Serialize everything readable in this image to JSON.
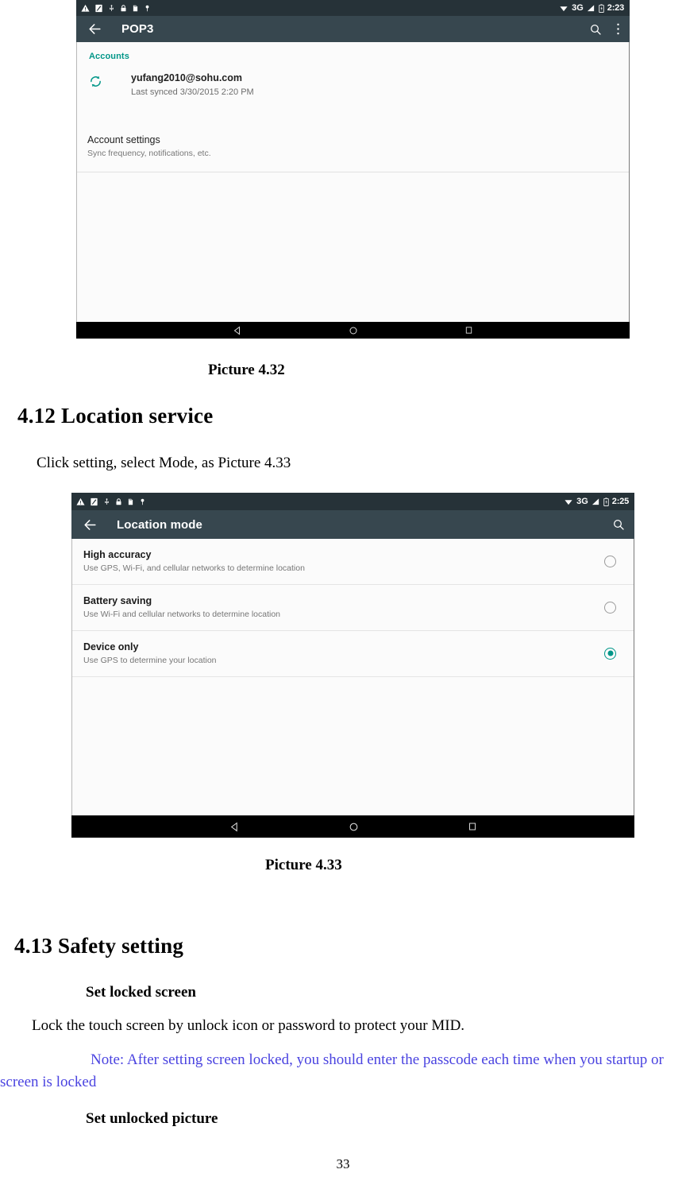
{
  "document": {
    "page_number": "33",
    "caption_1": "Picture 4.32",
    "caption_2": "Picture 4.33",
    "heading_412": "4.12 Location service",
    "paragraph_412": "Click setting, select Mode, as Picture 4.33",
    "heading_413": "4.13   Safety setting",
    "sub_locked": "Set locked screen",
    "paragraph_lock": "Lock the touch screen by unlock icon or password to protect your MID.",
    "note_text": "Note: After setting screen locked, you should enter the passcode each time when you startup or screen is locked",
    "note_color": "#4a43e0",
    "sub_unlocked": "Set unlocked picture"
  },
  "screenshot_pop3": {
    "status_bar": {
      "icons": [
        "warning-triangle-icon",
        "screenshot-icon",
        "usb-icon",
        "lock-icon",
        "sdcard-icon",
        "location-pin-icon"
      ],
      "wifi_icon": "wifi-icon",
      "network_label": "3G",
      "signal_icon": "signal-bars-icon",
      "battery_icon": "battery-icon",
      "time": "2:23"
    },
    "app_bar": {
      "back_icon": "back-arrow-icon",
      "title": "POP3",
      "search_icon": "search-icon",
      "overflow_icon": "more-vertical-icon"
    },
    "accounts_section_label": "Accounts",
    "account": {
      "sync_icon": "sync-icon",
      "email": "yufang2010@sohu.com",
      "last_synced": "Last synced 3/30/2015 2:20 PM"
    },
    "account_settings": {
      "title": "Account settings",
      "subtitle": "Sync frequency, notifications, etc."
    },
    "nav_bar": {
      "back": "nav-back-triangle-icon",
      "home": "nav-home-circle-icon",
      "recents": "nav-recents-square-icon"
    },
    "accent_color": "#009688"
  },
  "screenshot_location": {
    "status_bar": {
      "icons": [
        "warning-triangle-icon",
        "screenshot-icon",
        "usb-icon",
        "lock-icon",
        "sdcard-icon",
        "location-pin-icon"
      ],
      "wifi_icon": "wifi-icon",
      "network_label": "3G",
      "signal_icon": "signal-bars-icon",
      "battery_icon": "battery-icon",
      "time": "2:25"
    },
    "app_bar": {
      "back_icon": "back-arrow-icon",
      "title": "Location mode",
      "search_icon": "search-icon"
    },
    "options": [
      {
        "title": "High accuracy",
        "subtitle": "Use GPS, Wi-Fi, and cellular networks to determine location",
        "selected": false
      },
      {
        "title": "Battery saving",
        "subtitle": "Use Wi-Fi and cellular networks to determine location",
        "selected": false
      },
      {
        "title": "Device only",
        "subtitle": "Use GPS to determine your location",
        "selected": true
      }
    ],
    "nav_bar": {
      "back": "nav-back-triangle-icon",
      "home": "nav-home-circle-icon",
      "recents": "nav-recents-square-icon"
    },
    "accent_color": "#009688"
  }
}
